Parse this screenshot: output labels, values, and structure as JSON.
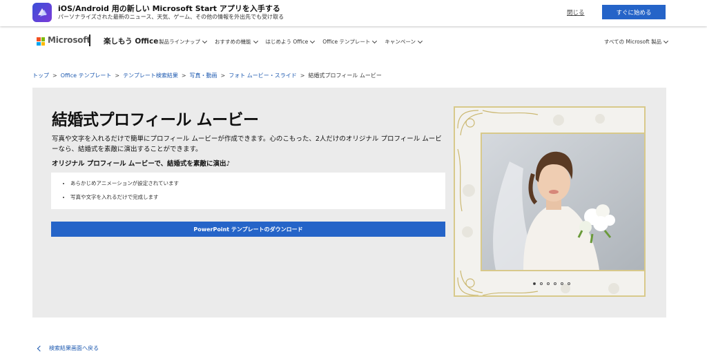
{
  "promo": {
    "title": "iOS/Android 用の新しい Microsoft Start アプリを入手する",
    "subtitle": "パーソナライズされた最新のニュース、天気、ゲーム、その他の情報を外出先でも受け取る",
    "close_label": "閉じる",
    "start_label": "すぐに始める",
    "icon": "microsoft-start-app-icon"
  },
  "header": {
    "logo_text": "Microsoft",
    "brand": "楽しもう Office",
    "nav": [
      "製品ラインナップ",
      "おすすめの機能",
      "はじめよう Office",
      "Office テンプレート",
      "キャンペーン"
    ],
    "all_products": "すべての Microsoft 製品"
  },
  "breadcrumb": {
    "links": [
      "トップ",
      "Office テンプレート",
      "テンプレート検索結果",
      "写真・動画",
      "フォト ムービー・スライド"
    ],
    "current": "結婚式プロフィール ムービー",
    "separator": ">"
  },
  "hero": {
    "title": "結婚式プロフィール ムービー",
    "description": "写真や文字を入れるだけで簡単にプロフィール ムービーが作成できます。心のこもった、2人だけのオリジナル プロフィール ムービーなら、結婚式を素敵に演出することができます。",
    "subheading": "オリジナル プロフィール ムービーで、結婚式を素敵に演出♪",
    "features": [
      "あらかじめアニメーションが設定されています",
      "写真や文字を入れるだけで完成します"
    ],
    "download_label": "PowerPoint テンプレートのダウンロード"
  },
  "preview": {
    "slide_count": 6,
    "active_slide": 1
  },
  "back_link": "検索結果画面へ戻る",
  "colors": {
    "accent": "#2564c8",
    "link": "#1e5ab0",
    "hero_bg": "#ebebeb",
    "frame_gold": "#d8c98a",
    "ms_red": "#f25022",
    "ms_green": "#7fba00",
    "ms_blue": "#00a4ef",
    "ms_yellow": "#ffb900"
  }
}
